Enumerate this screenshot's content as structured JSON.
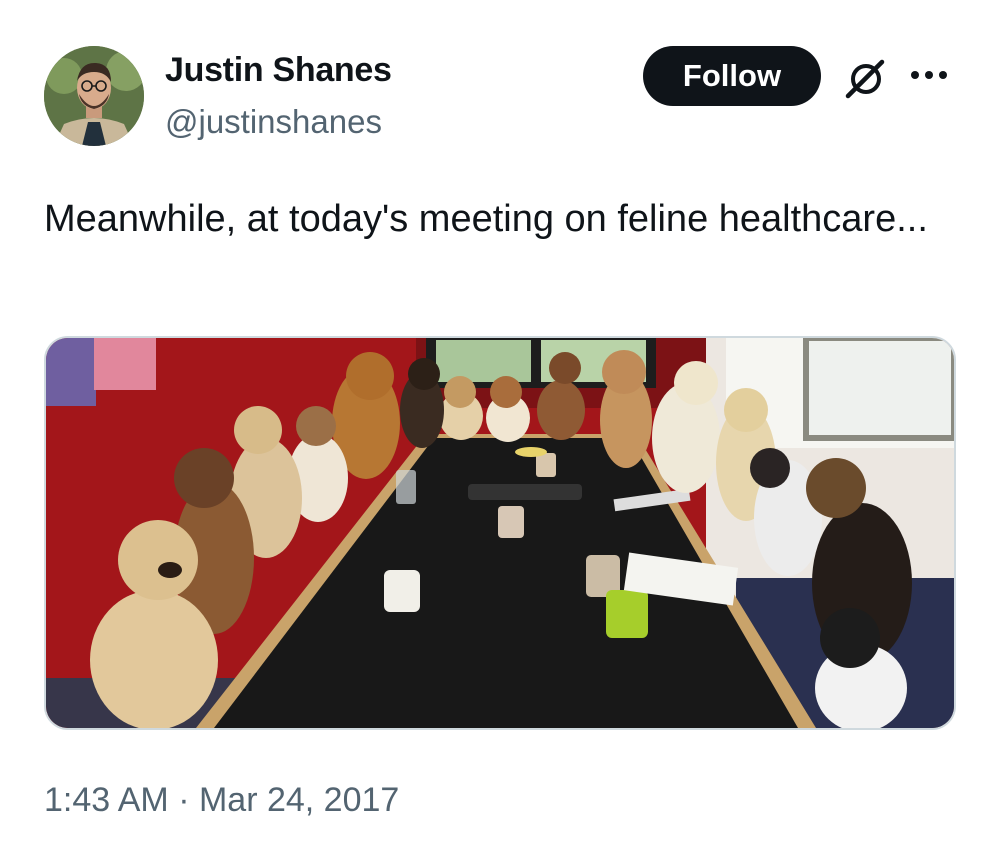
{
  "author": {
    "display_name": "Justin Shanes",
    "handle": "@justinshanes"
  },
  "actions": {
    "follow_label": "Follow",
    "grok_icon": "grok-slash-icon",
    "more_icon": "more-dots-icon"
  },
  "tweet": {
    "text": "Meanwhile, at today's meeting on feline healthcare...",
    "timestamp": "1:43 AM · Mar 24, 2017"
  },
  "media": {
    "description": "photo"
  },
  "colors": {
    "text": "#0f1419",
    "secondary": "#536471",
    "button_bg": "#0f1419",
    "border": "#cfd9de"
  }
}
